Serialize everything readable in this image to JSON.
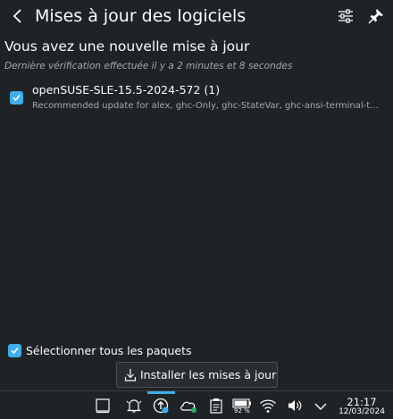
{
  "header": {
    "title": "Mises à jour des logiciels"
  },
  "summary": {
    "subtitle": "Vous avez une nouvelle mise à jour",
    "last_check": "Dernière vérification effectuée il y a 2 minutes et 8 secondes"
  },
  "updates": [
    {
      "name": "openSUSE-SLE-15.5-2024-572 (1)",
      "description": "Recommended update for alex, ghc-Only, ghc-StateVar, ghc-ansi-terminal-t...",
      "checked": true
    }
  ],
  "footer": {
    "select_all_label": "Sélectionner tous les paquets",
    "select_all_checked": true,
    "install_label": "Installer les mises à jour"
  },
  "taskbar": {
    "battery_percent": "92 %",
    "time": "21:17",
    "date": "12/03/2024"
  },
  "colors": {
    "background": "#202326",
    "accent": "#3daee9",
    "text": "#fcfcfc",
    "muted_text": "#a1a9b1"
  }
}
